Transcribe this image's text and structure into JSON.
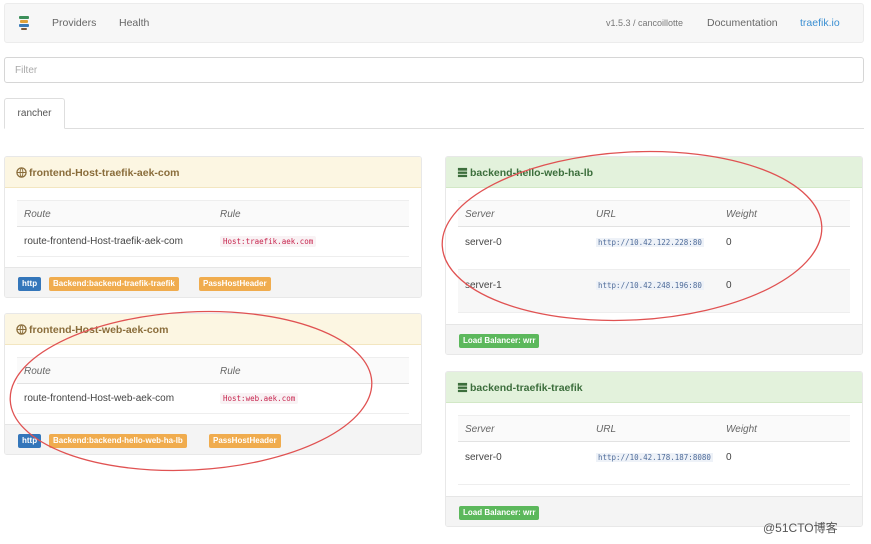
{
  "navbar": {
    "brand_icon": "traefik-logo-icon",
    "providers_label": "Providers",
    "health_label": "Health",
    "version_label": "v1.5.3 / cancoillotte",
    "documentation_label": "Documentation",
    "site_label": "traefik.io"
  },
  "filter": {
    "placeholder": "Filter"
  },
  "tabs": [
    {
      "label": "rancher",
      "active": true
    }
  ],
  "frontends": [
    {
      "title": "frontend-Host-traefik-aek-com",
      "icon": "globe-icon",
      "columns": [
        "Route",
        "Rule"
      ],
      "rows": [
        {
          "route": "route-frontend-Host-traefik-aek-com",
          "rule": "Host:traefik.aek.com"
        }
      ],
      "badges": [
        "http",
        "Backend:backend-traefik-traefik",
        "PassHostHeader"
      ]
    },
    {
      "title": "frontend-Host-web-aek-com",
      "icon": "globe-icon",
      "columns": [
        "Route",
        "Rule"
      ],
      "rows": [
        {
          "route": "route-frontend-Host-web-aek-com",
          "rule": "Host:web.aek.com"
        }
      ],
      "badges": [
        "http",
        "Backend:backend-hello-web-ha-lb",
        "PassHostHeader"
      ]
    }
  ],
  "backends": [
    {
      "title": "backend-hello-web-ha-lb",
      "icon": "server-icon",
      "columns": [
        "Server",
        "URL",
        "Weight"
      ],
      "rows": [
        {
          "server": "server-0",
          "url": "http://10.42.122.228:80",
          "weight": "0"
        },
        {
          "server": "server-1",
          "url": "http://10.42.248.196:80",
          "weight": "0"
        }
      ],
      "badge": "Load Balancer: wrr"
    },
    {
      "title": "backend-traefik-traefik",
      "icon": "server-icon",
      "columns": [
        "Server",
        "URL",
        "Weight"
      ],
      "rows": [
        {
          "server": "server-0",
          "url": "http://10.42.178.187:8080",
          "weight": "0"
        }
      ],
      "badge": "Load Balancer: wrr"
    }
  ],
  "colors": {
    "warning_header": "#fcf6e2",
    "success_header": "#e3f2dc",
    "badge_blue": "#3476ba",
    "badge_orange": "#f0ac4e",
    "badge_green": "#5cb85c",
    "annotation_red": "#e05252",
    "link_blue": "#3a8fd2"
  },
  "watermark": "@51CTO博客"
}
